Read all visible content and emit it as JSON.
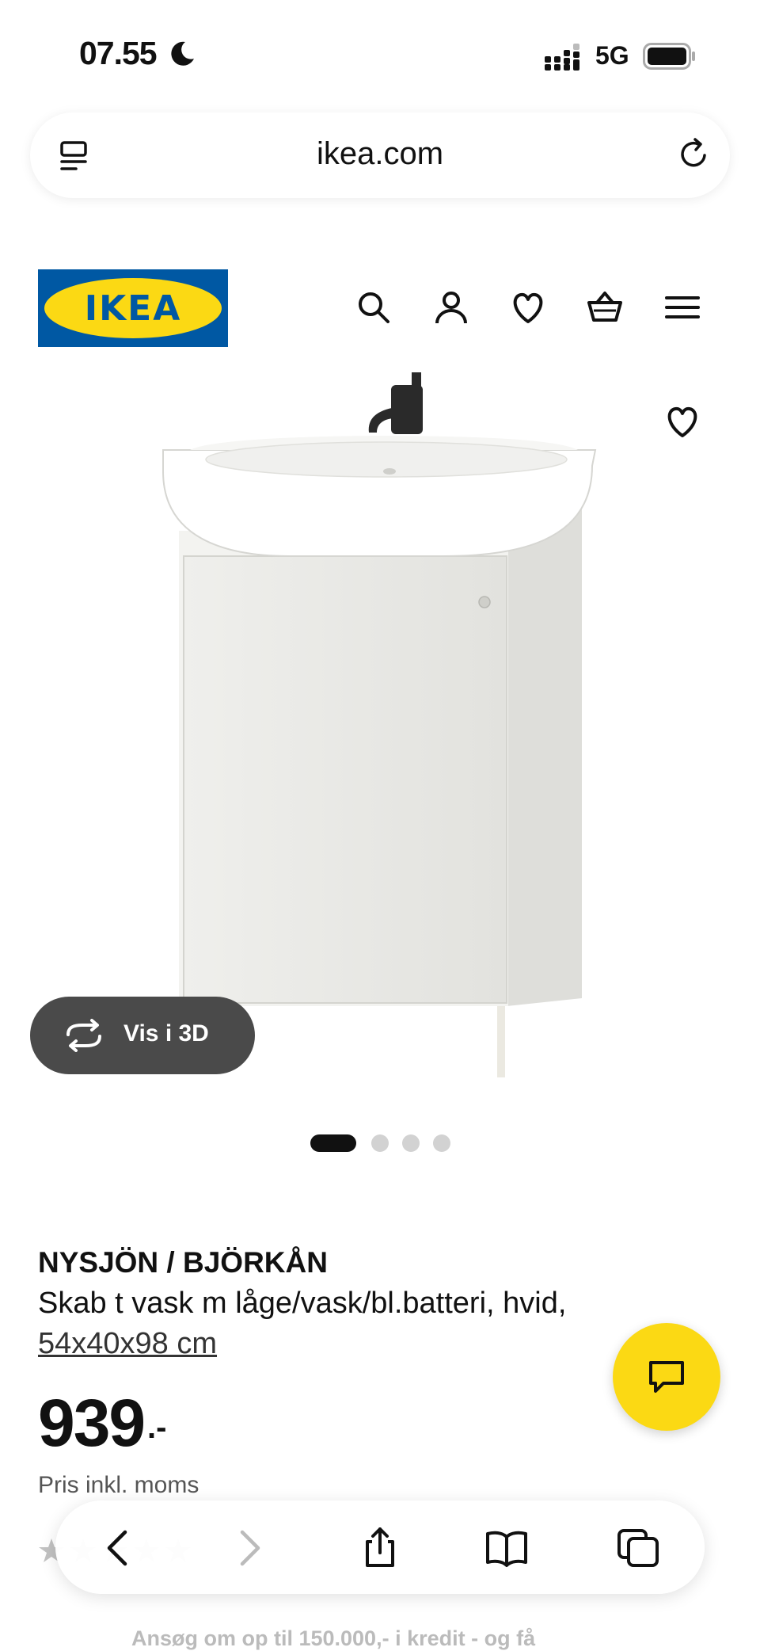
{
  "status_bar": {
    "time": "07.55",
    "network": "5G",
    "icons": [
      "moon-icon",
      "signal-icon",
      "battery-icon"
    ]
  },
  "browser": {
    "url": "ikea.com",
    "icons": [
      "tabs-menu-icon",
      "reload-icon"
    ]
  },
  "header": {
    "logo_text": "IKEA",
    "icons": [
      "search-icon",
      "account-icon",
      "wishlist-icon",
      "cart-icon",
      "menu-icon"
    ],
    "colors": {
      "logo_blue": "#0058a3",
      "logo_yellow": "#fbd914"
    }
  },
  "product": {
    "favorite_icon": "heart-icon",
    "view_3d_label": "Vis i 3D",
    "carousel": {
      "total": 4,
      "active": 1
    },
    "name": "NYSJÖN / BJÖRKÅN",
    "description": "Skab t vask m låge/vask/bl.batteri, hvid,",
    "size": "54x40x98 cm",
    "price": "939",
    "price_suffix": ".-",
    "price_note": "Pris inkl. moms"
  },
  "chat": {
    "icon": "chat-bubble-icon",
    "color": "#fbd914"
  },
  "partial_below": {
    "credit_text": "Ansøg om op til 150.000,- i kredit - og få"
  },
  "toolbar": {
    "icons": [
      "back-icon",
      "forward-icon",
      "share-icon",
      "bookmarks-icon",
      "tabs-icon"
    ]
  }
}
